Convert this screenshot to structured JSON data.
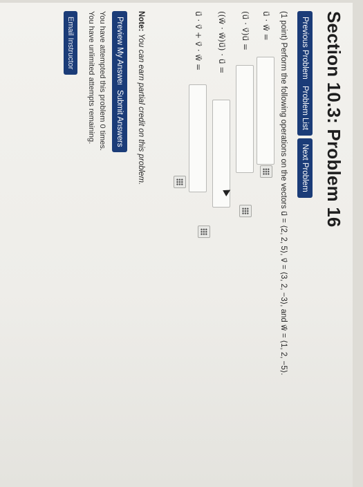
{
  "title": "Section 10.3: Problem 16",
  "nav": {
    "previous": "Previous Problem",
    "list": "Problem List",
    "next": "Next Problem"
  },
  "problem": {
    "statement": "(1 point) Perform the following operations on the vectors u⃗ = ⟨2, 2, 5⟩, v⃗ = ⟨3, 2, −3⟩, and w⃗ = ⟨1, 2, −5⟩.",
    "rows": [
      {
        "label": "u⃗ · w⃗ =",
        "value": ""
      },
      {
        "label": "(u⃗ · v⃗)u⃗ =",
        "value": ""
      },
      {
        "label": "((w⃗ · w⃗)u⃗) · u⃗ =",
        "value": ""
      },
      {
        "label": "u⃗ · v⃗ + v⃗ · w⃗ =",
        "value": ""
      }
    ]
  },
  "note": {
    "bold": "Note:",
    "text": "You can earn partial credit on this problem."
  },
  "actions": {
    "preview": "Preview My Answers",
    "submit": "Submit Answers"
  },
  "status": {
    "attempts": "You have attempted this problem 0 times.",
    "remaining": "You have unlimited attempts remaining."
  },
  "email": "Email Instructor"
}
